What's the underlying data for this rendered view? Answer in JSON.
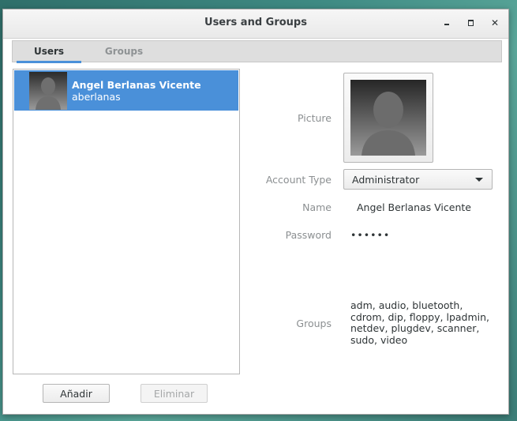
{
  "window": {
    "title": "Users and Groups"
  },
  "tabs": [
    {
      "label": "Users",
      "active": true
    },
    {
      "label": "Groups",
      "active": false
    }
  ],
  "user_list": [
    {
      "full_name": "Angel Berlanas Vicente",
      "login": "aberlanas",
      "selected": true
    }
  ],
  "buttons": {
    "add": "Añadir",
    "remove": "Eliminar"
  },
  "details": {
    "picture_label": "Picture",
    "account_type_label": "Account Type",
    "account_type_value": "Administrator",
    "name_label": "Name",
    "name_value": "Angel Berlanas Vicente",
    "password_label": "Password",
    "password_value": "••••••",
    "groups_label": "Groups",
    "groups_value": "adm, audio, bluetooth, cdrom, dip, floppy, lpadmin, netdev, plugdev, scanner, sudo, video"
  },
  "colors": {
    "selection": "#4a90d9",
    "desktop": "#3f8b84"
  },
  "icons": {
    "minimize": "minimize-icon",
    "maximize": "maximize-icon",
    "close": "close-icon",
    "dropdown": "chevron-down-icon",
    "avatar": "user-silhouette-icon"
  }
}
